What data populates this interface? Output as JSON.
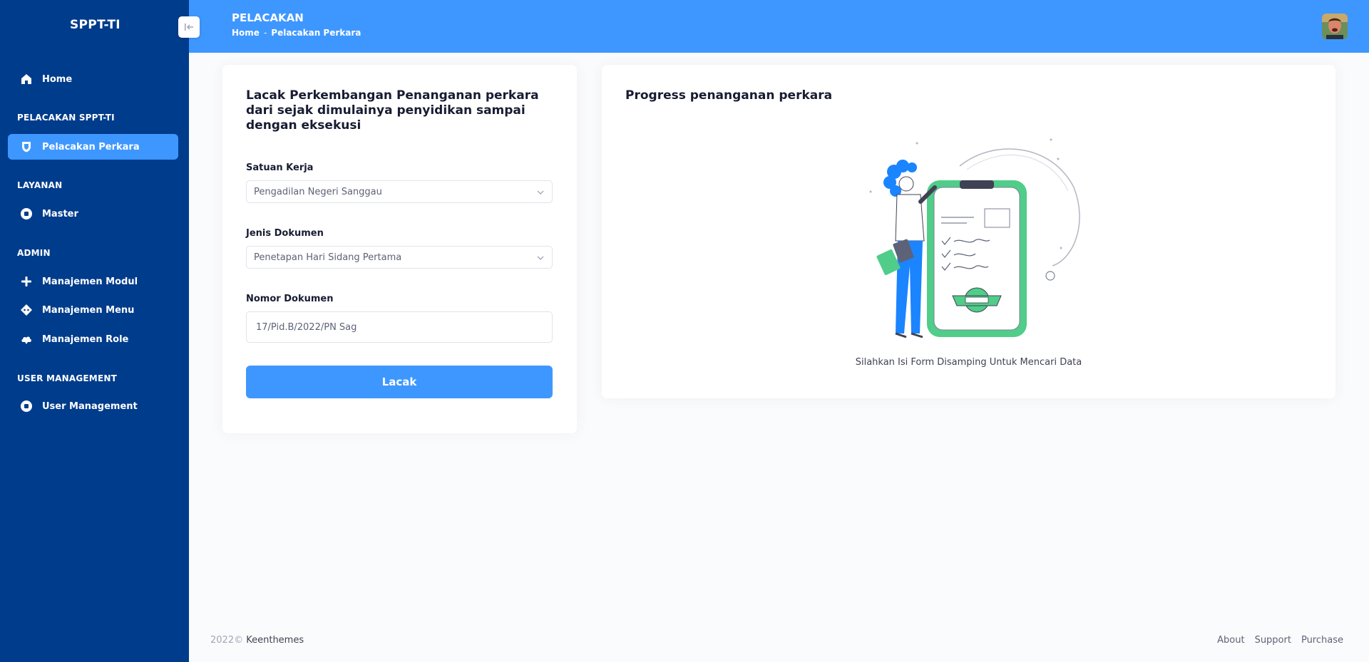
{
  "sidebar": {
    "brand": "SPPT-TI",
    "items": {
      "home": "Home",
      "pelacakan_perkara": "Pelacakan Perkara",
      "master": "Master",
      "manajemen_modul": "Manajemen Modul",
      "manajemen_menu": "Manajemen Menu",
      "manajemen_role": "Manajemen Role",
      "user_management": "User Management"
    },
    "sections": {
      "pelacakan": "PELACAKAN SPPT-TI",
      "layanan": "LAYANAN",
      "admin": "ADMIN",
      "user_management": "USER MANAGEMENT"
    }
  },
  "header": {
    "title": "PELACAKAN",
    "breadcrumb": [
      "Home",
      "-",
      "Pelacakan Perkara"
    ]
  },
  "form": {
    "heading": "Lacak Perkembangan Penanganan perkara dari sejak dimulainya penyidikan sampai dengan eksekusi",
    "satuan_kerja_label": "Satuan Kerja",
    "satuan_kerja_value": "Pengadilan Negeri Sanggau",
    "jenis_dokumen_label": "Jenis Dokumen",
    "jenis_dokumen_value": "Penetapan Hari Sidang Pertama",
    "nomor_dokumen_label": "Nomor Dokumen",
    "nomor_dokumen_value": "17/Pid.B/2022/PN Sag",
    "submit_label": "Lacak"
  },
  "progress": {
    "title": "Progress penanganan perkara",
    "hint": "Silahkan Isi Form Disamping Untuk Mencari Data"
  },
  "footer": {
    "year": "2022©",
    "company": "Keenthemes",
    "links": [
      "About",
      "Support",
      "Purchase"
    ]
  },
  "colors": {
    "sidebar_bg": "#003c8c",
    "accent": "#3e97ff",
    "illustration_green": "#50cd89"
  }
}
